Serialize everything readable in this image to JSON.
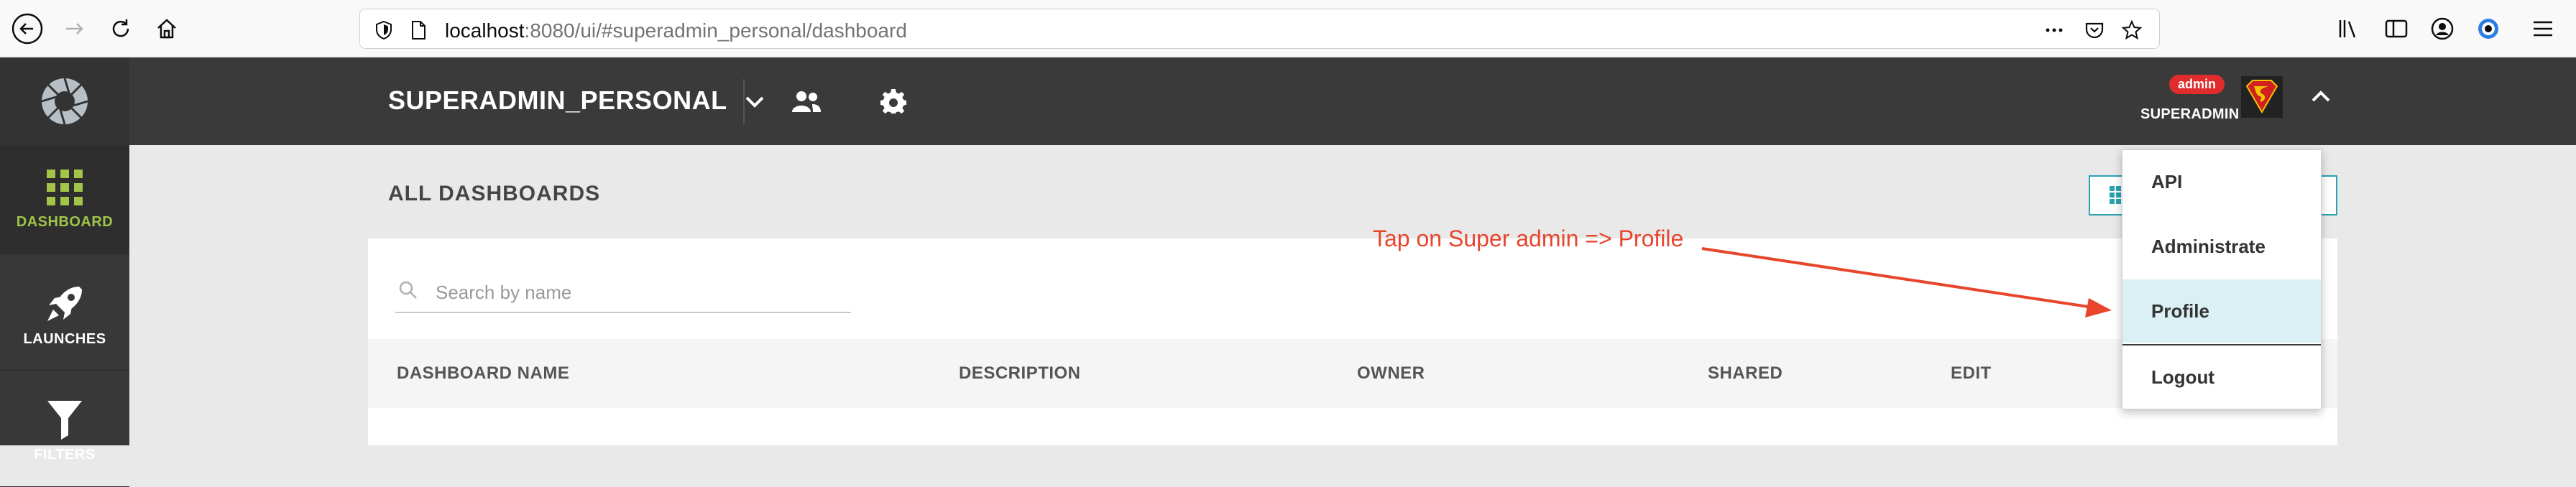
{
  "browser": {
    "url_host": "localhost",
    "url_path": ":8080/ui/#superadmin_personal/dashboard"
  },
  "header": {
    "project_name": "SUPERADMIN_PERSONAL",
    "user": {
      "badge": "admin",
      "name": "SUPERADMIN"
    }
  },
  "sidebar": {
    "items": [
      {
        "label": "DASHBOARD",
        "icon": "dashboard-grid-icon",
        "active": true
      },
      {
        "label": "LAUNCHES",
        "icon": "rocket-icon",
        "active": false
      },
      {
        "label": "FILTERS",
        "icon": "filter-icon",
        "active": false
      }
    ]
  },
  "main": {
    "title": "ALL DASHBOARDS",
    "search_placeholder": "Search by name",
    "columns": [
      "DASHBOARD NAME",
      "DESCRIPTION",
      "OWNER",
      "SHARED",
      "EDIT"
    ]
  },
  "user_menu": {
    "items": [
      "API",
      "Administrate",
      "Profile",
      "Logout"
    ],
    "selected": "Profile"
  },
  "annotation": {
    "text": "Tap on Super admin => Profile",
    "color": "#e8452c"
  },
  "colors": {
    "accent": "#a2c449",
    "header_bg": "#3a3a3a",
    "badge": "#e02c2c",
    "teal": "#29a3b1"
  }
}
